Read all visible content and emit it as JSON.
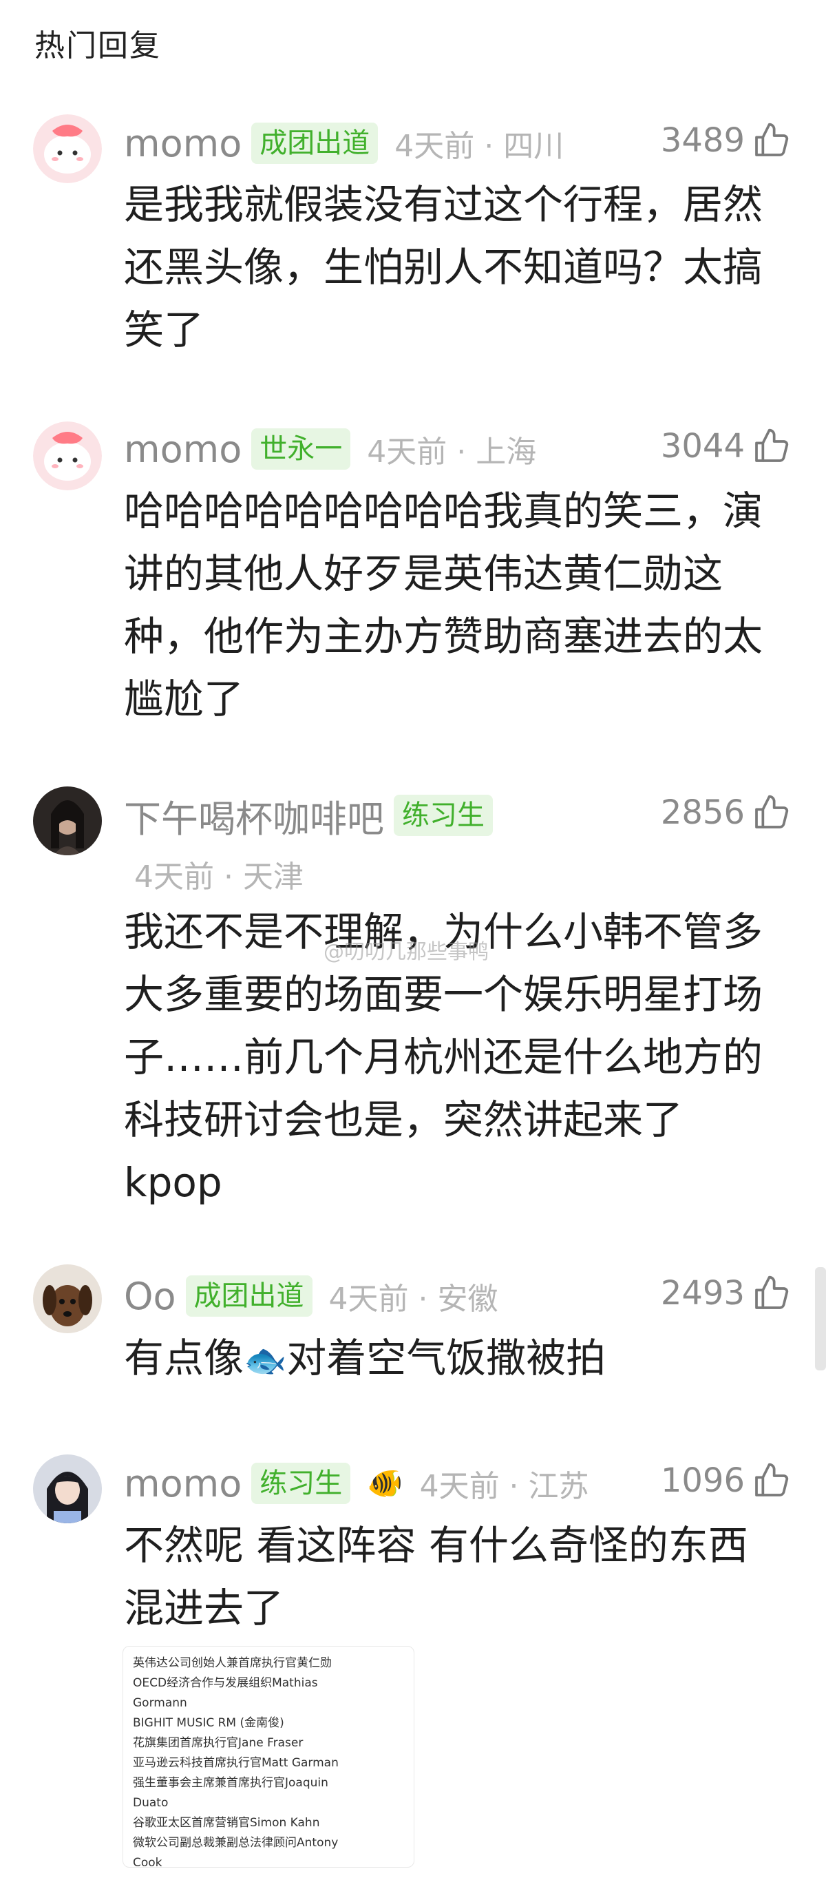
{
  "header": {
    "title": "热门回复"
  },
  "watermark": "@叨叨几那些事鸭",
  "comments": [
    {
      "username": "momo",
      "badge": "成团出道",
      "time_loc": "4天前 · 四川",
      "likes": "3489",
      "content": "是我我就假装没有过这个行程，居然还黑头像，生怕别人不知道吗？太搞笑了",
      "avatar": "pink-cartoon-avatar"
    },
    {
      "username": "momo",
      "badge": "世永一",
      "time_loc": "4天前 · 上海",
      "likes": "3044",
      "content": "哈哈哈哈哈哈哈哈哈我真的笑三，演讲的其他人好歹是英伟达黄仁勋这种，他作为主办方赞助商塞进去的太尴尬了",
      "avatar": "pink-cartoon-avatar"
    },
    {
      "username": "下午喝杯咖啡吧",
      "badge": "练习生",
      "time_loc": "4天前 · 天津",
      "likes": "2856",
      "content": "我还不是不理解，为什么小韩不管多大多重要的场面要一个娱乐明星打场子……前几个月杭州还是什么地方的科技研讨会也是，突然讲起来了kpop",
      "avatar": "dark-photo-avatar"
    },
    {
      "username": "Oo",
      "badge": "成团出道",
      "time_loc": "4天前 · 安徽",
      "likes": "2493",
      "content_before": "有点像",
      "content_emoji": "🐟",
      "content_after": "对着空气饭撒被拍",
      "avatar": "dog-photo-avatar"
    },
    {
      "username": "momo",
      "badge": "练习生",
      "badge_emoji": "🐠",
      "time_loc": "4天前 · 江苏",
      "likes": "1096",
      "content": "不然呢 看这阵容 有什么奇怪的东西混进去了",
      "avatar": "girl-photo-avatar"
    }
  ],
  "info_card": {
    "lines": [
      "英伟达公司创始人兼首席执行官黄仁勋",
      "OECD经济合作与发展组织Mathias",
      "Gormann",
      "BIGHIT MUSIC RM (金南俊)",
      "花旗集团首席执行官Jane Fraser",
      "亚马逊云科技首席执行官Matt Garman",
      "强生董事会主席兼首席执行官Joaquin",
      "Duato",
      "谷歌亚太区首席营销官Simon Kahn",
      "微软公司副总裁兼副总法律顾问Antony",
      "Cook"
    ]
  },
  "colors": {
    "badge_text": "#41b02c",
    "badge_bg": "#e7f6e3",
    "meta_gray": "#b5b5b5",
    "name_gray": "#8a8a8a"
  }
}
